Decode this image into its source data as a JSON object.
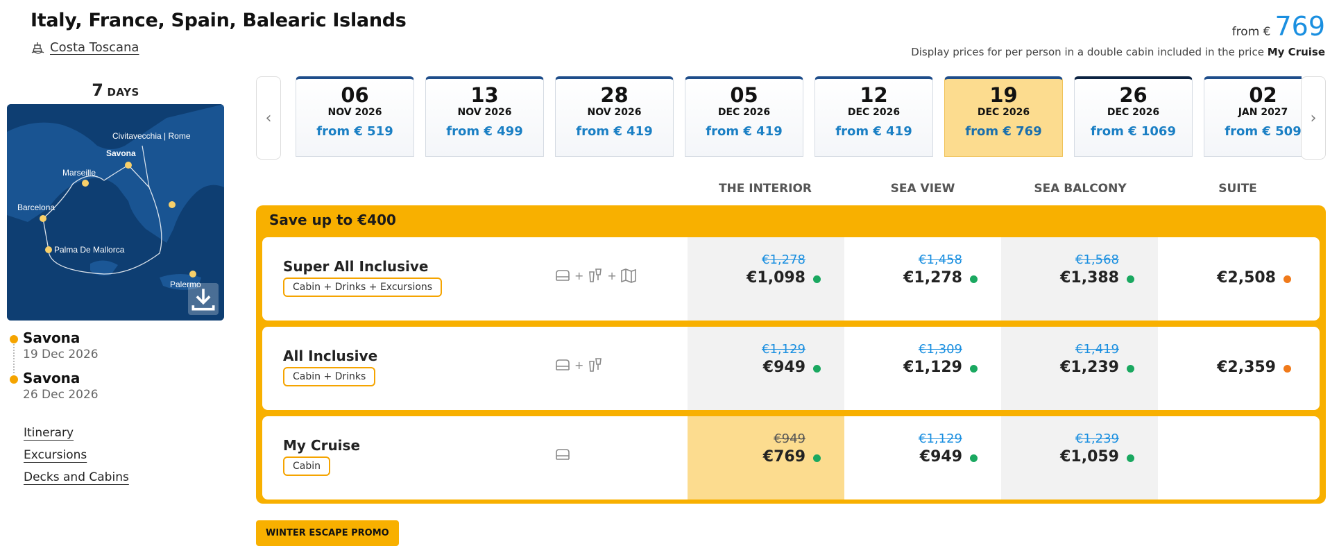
{
  "header": {
    "title": "Italy, France, Spain, Balearic Islands",
    "ship": "Costa Toscana",
    "from_label": "from €",
    "from_price": "769",
    "note_prefix": "Display prices for per person in a double cabin included in the price",
    "note_bold": "My Cruise"
  },
  "itinerary": {
    "days_num": "7",
    "days_label": "DAYS",
    "map_labels": [
      "Civitavecchia | Rome",
      "Savona",
      "Marseille",
      "Barcelona",
      "Palma De Mallorca",
      "Palermo"
    ],
    "embark": {
      "port": "Savona",
      "date": "19 Dec 2026"
    },
    "disembark": {
      "port": "Savona",
      "date": "26 Dec 2026"
    }
  },
  "side_links": [
    "Itinerary",
    "Excursions",
    "Decks and Cabins"
  ],
  "dates": [
    {
      "day": "06",
      "month": "NOV 2026",
      "price": "from € 519"
    },
    {
      "day": "13",
      "month": "NOV 2026",
      "price": "from € 499"
    },
    {
      "day": "28",
      "month": "NOV 2026",
      "price": "from € 419"
    },
    {
      "day": "05",
      "month": "DEC 2026",
      "price": "from € 419"
    },
    {
      "day": "12",
      "month": "DEC 2026",
      "price": "from € 419"
    },
    {
      "day": "19",
      "month": "DEC 2026",
      "price": "from € 769",
      "selected": true
    },
    {
      "day": "26",
      "month": "DEC 2026",
      "price": "from € 1069"
    },
    {
      "day": "02",
      "month": "JAN 2027",
      "price": "from € 509"
    }
  ],
  "nav": {
    "prev": "‹",
    "next": "›"
  },
  "columns": [
    "THE INTERIOR",
    "SEA VIEW",
    "SEA BALCONY",
    "SUITE"
  ],
  "save_title": "Save up to €400",
  "rows": [
    {
      "name": "Super All Inclusive",
      "tag": "Cabin + Drinks + Excursions",
      "icons": [
        "cabin-icon",
        "drinks-icon",
        "excursion-map-icon"
      ],
      "prices": [
        {
          "old": "€1,278",
          "new": "€1,098",
          "availability": "available"
        },
        {
          "old": "€1,458",
          "new": "€1,278",
          "availability": "available"
        },
        {
          "old": "€1,568",
          "new": "€1,388",
          "availability": "available"
        },
        {
          "old": "",
          "new": "€2,508",
          "availability": "limited"
        }
      ]
    },
    {
      "name": "All Inclusive",
      "tag": "Cabin + Drinks",
      "icons": [
        "cabin-icon",
        "drinks-icon"
      ],
      "prices": [
        {
          "old": "€1,129",
          "new": "€949",
          "availability": "available"
        },
        {
          "old": "€1,309",
          "new": "€1,129",
          "availability": "available"
        },
        {
          "old": "€1,419",
          "new": "€1,239",
          "availability": "available"
        },
        {
          "old": "",
          "new": "€2,359",
          "availability": "limited"
        }
      ]
    },
    {
      "name": "My Cruise",
      "tag": "Cabin",
      "icons": [
        "cabin-icon"
      ],
      "prices": [
        {
          "old": "€949",
          "new": "€769",
          "availability": "available",
          "selected": true
        },
        {
          "old": "€1,129",
          "new": "€949",
          "availability": "available"
        },
        {
          "old": "€1,239",
          "new": "€1,059",
          "availability": "available"
        },
        {
          "old": "",
          "new": "",
          "availability": ""
        }
      ]
    }
  ],
  "promo_label": "WINTER ESCAPE PROMO",
  "colors": {
    "accent": "#f8b000",
    "price_blue": "#1a8fe0",
    "available": "#1aa860",
    "limited": "#f07a1a",
    "selected": "#fcdc8f"
  }
}
